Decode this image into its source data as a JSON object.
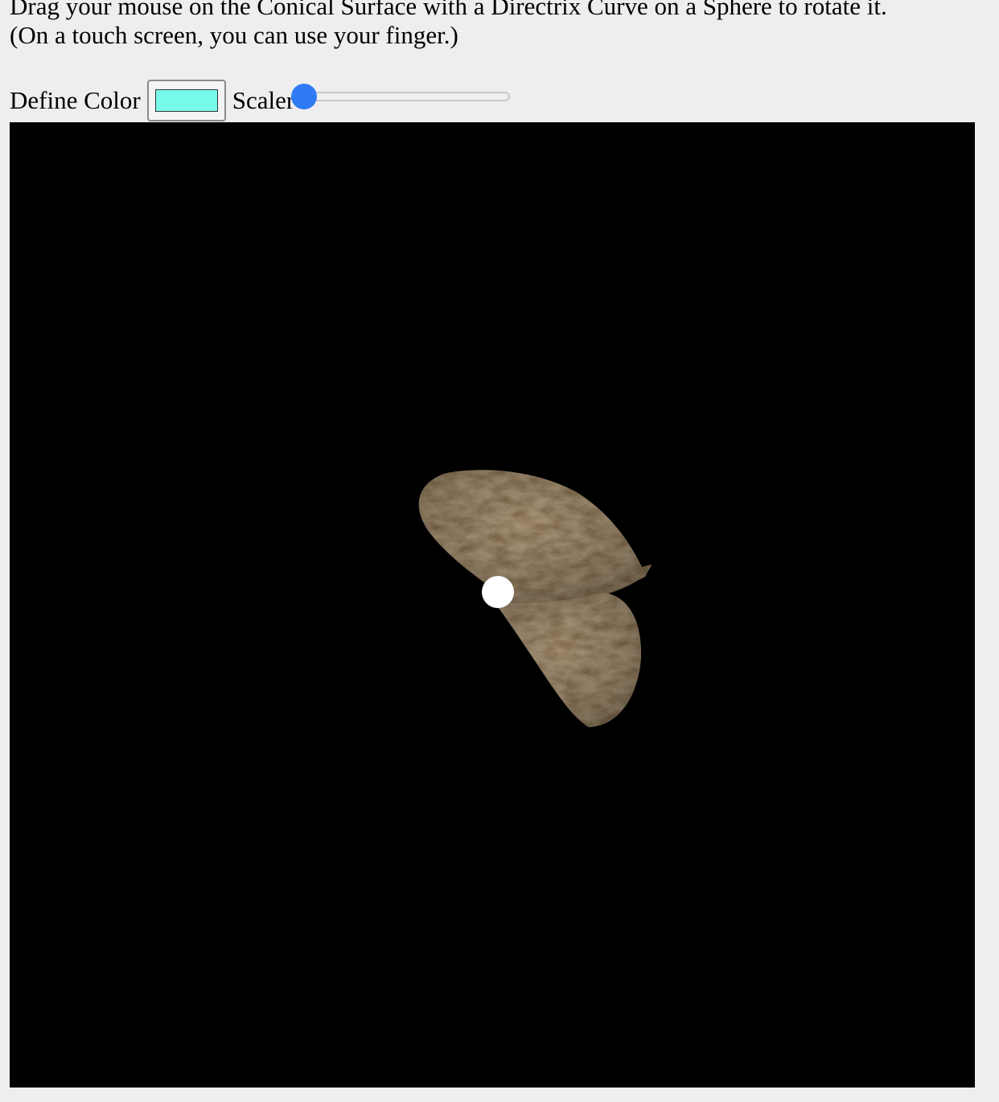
{
  "instructions": {
    "line1": "Drag your mouse on the Conical Surface with a Directrix Curve on a Sphere to rotate it.",
    "line2": "(On a touch screen, you can use your finger.)"
  },
  "controls": {
    "define_color_label": "Define Color",
    "color_value": "#77fae9",
    "scaler_label": "Scaler",
    "scaler_value": 0
  },
  "scene": {
    "background_color": "#000000",
    "surface_texture": "stone-texture",
    "surface_color": "#8b7a62",
    "vertex_sphere_color": "#ffffff"
  }
}
